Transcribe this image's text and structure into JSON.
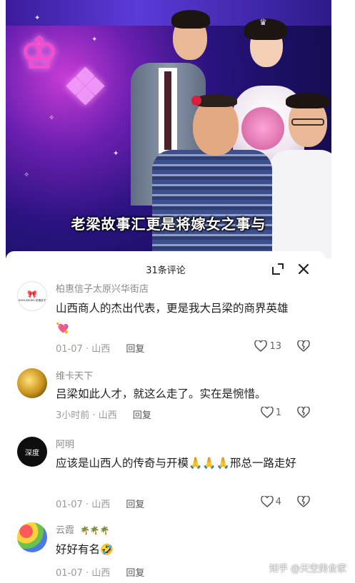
{
  "video": {
    "subtitle": "老梁故事汇更是将嫁女之事与"
  },
  "sheet": {
    "title": "31条评论",
    "collapse_icon": "collapse-icon",
    "close_icon": "close-icon"
  },
  "comments": [
    {
      "user": "柏惠信子太原兴华街店",
      "avatar_label": "BOHUIZKIDS 柏惠信子",
      "text": "山西商人的杰出代表，更是我大吕梁的商界英雄",
      "emoji": "💘",
      "date": "01-07",
      "location": "山西",
      "reply": "回复",
      "likes": "13"
    },
    {
      "user": "维卡天下",
      "text": "吕梁如此人才，就这么走了。实在是惋惜。",
      "date": "3小时前",
      "location": "山西",
      "reply": "回复",
      "likes": "1"
    },
    {
      "user": "阿明",
      "avatar_label": "深度",
      "text": "应该是山西人的传奇与开模🙏🙏🙏邢总一路走好",
      "date": "01-07",
      "location": "山西",
      "reply": "回复",
      "likes": "4"
    },
    {
      "user": "云霞",
      "user_badges": "🌴🌴🌴",
      "text": "好好有名",
      "emoji": "🤣",
      "date": "01-07",
      "location": "山西",
      "reply": "回复",
      "likes": ""
    }
  ],
  "separator": "·",
  "watermark": "知乎 @天空美食家",
  "colors": {
    "sheet_bg": "#ffffff",
    "meta_text": "#9a9a9a",
    "name_text": "#8a8a8a"
  }
}
